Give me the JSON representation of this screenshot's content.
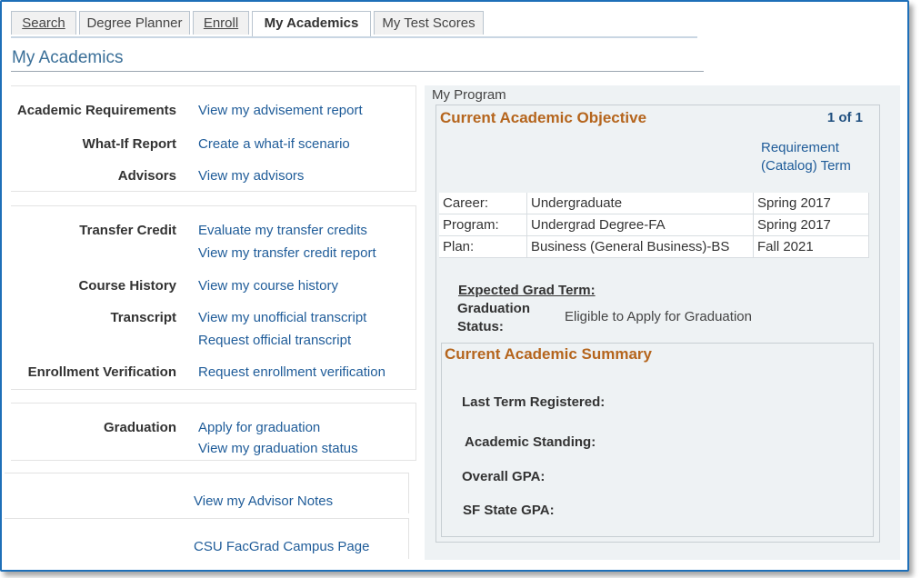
{
  "tabs": [
    {
      "label": "Search"
    },
    {
      "label": "Degree Planner"
    },
    {
      "label": "Enroll"
    },
    {
      "label": "My Academics"
    },
    {
      "label": "My Test Scores"
    }
  ],
  "page": {
    "title": "My Academics"
  },
  "left": {
    "panel1": [
      {
        "label": "Academic Requirements",
        "link": "View my advisement report"
      },
      {
        "label": "What-If Report",
        "link": "Create a what-if scenario"
      },
      {
        "label": "Advisors",
        "link": "View my advisors"
      }
    ],
    "panel2": {
      "transfer_label": "Transfer Credit",
      "transfer_link1": "Evaluate my transfer credits",
      "transfer_link2": "View my transfer credit report",
      "history_label": "Course History",
      "history_link": "View my course history",
      "transcript_label": "Transcript",
      "transcript_link1": "View my unofficial transcript",
      "transcript_link2": "Request official transcript",
      "enroll_label": "Enrollment Verification",
      "enroll_link": "Request enrollment verification"
    },
    "panel3": {
      "grad_label": "Graduation",
      "grad_link1": "Apply for graduation",
      "grad_link2": "View my graduation status"
    },
    "advisor_notes": "View my Advisor Notes",
    "campus_page": "CSU FacGrad Campus Page"
  },
  "program": {
    "section_title": "My Program",
    "objective_title": "Current Academic Objective",
    "count": "1 of 1",
    "req_term_line1": "Requirement",
    "req_term_line2": "(Catalog) Term",
    "rows": [
      {
        "label": "Career:",
        "value": "Undergraduate",
        "term": "Spring 2017"
      },
      {
        "label": "Program:",
        "value": "Undergrad Degree-FA",
        "term": "Spring 2017"
      },
      {
        "label": "Plan:",
        "value": "Business (General Business)-BS",
        "term": "Fall 2021"
      }
    ],
    "expected_grad_label": "Expected Grad Term:",
    "grad_status_line1": "Graduation",
    "grad_status_line2": "Status:",
    "grad_status_value": "Eligible to Apply for Graduation"
  },
  "summary": {
    "title": "Current Academic Summary",
    "last_term": "Last Term Registered:",
    "standing": "Academic Standing:",
    "overall_gpa": "Overall GPA:",
    "sf_gpa": "SF State GPA:"
  }
}
